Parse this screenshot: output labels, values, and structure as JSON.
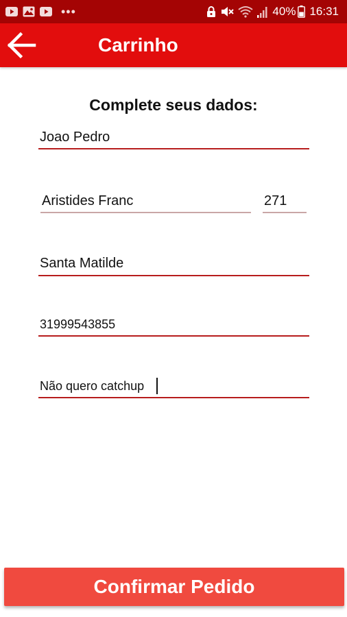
{
  "status_bar": {
    "battery_percent": "40%",
    "time": "16:31",
    "left_icons": [
      "youtube-icon",
      "gallery-icon",
      "youtube-icon",
      "more-dots-icon"
    ],
    "right_icons": [
      "lock-icon",
      "mute-icon",
      "wifi-icon",
      "signal-icon",
      "battery-icon"
    ]
  },
  "app_bar": {
    "title": "Carrinho",
    "back_icon": "arrow-left-icon"
  },
  "form": {
    "heading": "Complete seus dados:",
    "name": "Joao Pedro",
    "street": "Aristides Franc",
    "number": "271",
    "neighborhood": "Santa Matilde",
    "phone": "31999543855",
    "notes": "Não quero catchup"
  },
  "actions": {
    "confirm_label": "Confirmar Pedido"
  },
  "colors": {
    "status_bar": "#a40404",
    "app_bar": "#e20d0d",
    "confirm_button": "#f04a3f",
    "field_underline": "#b71c1c"
  }
}
